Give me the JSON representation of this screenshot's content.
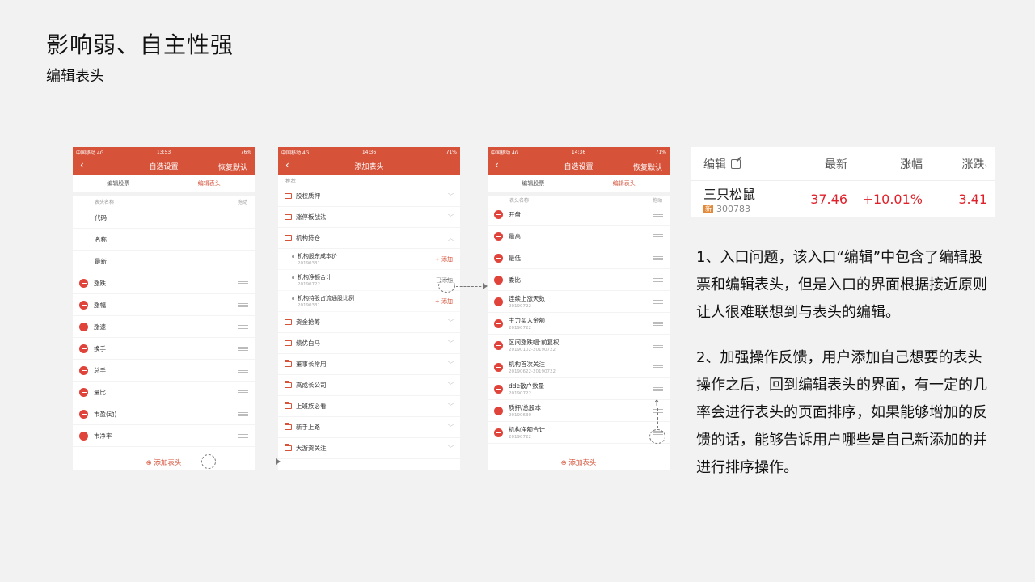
{
  "slide": {
    "title": "影响弱、自主性强",
    "subtitle": "编辑表头"
  },
  "status": {
    "carrier": "中国移动",
    "network": "4G"
  },
  "phone1": {
    "time": "13:53",
    "battery": "76%",
    "nav_title": "自选设置",
    "nav_right": "恢复默认",
    "tabs": [
      "编辑股票",
      "编辑表头"
    ],
    "col_name": "表头名称",
    "col_drag": "拖动",
    "fixed_items": [
      "代码",
      "名称",
      "最新"
    ],
    "items": [
      "涨跌",
      "涨幅",
      "涨速",
      "换手",
      "总手",
      "量比",
      "市盈(动)",
      "市净率"
    ],
    "add_label": "⊕ 添加表头"
  },
  "phone2": {
    "time": "14:36",
    "battery": "71%",
    "nav_title": "添加表头",
    "section": "推荐",
    "categories_top": [
      "股权质押",
      "涨停板战法",
      "机构持仓"
    ],
    "subitems": [
      {
        "name": "机构股东成本价",
        "date": "20190331",
        "action": "+ 添加"
      },
      {
        "name": "机构净额合计",
        "date": "20190722",
        "action": "已添加"
      },
      {
        "name": "机构持股占流通股比例",
        "date": "20190331",
        "action": "+ 添加"
      }
    ],
    "categories_bottom": [
      "资金抢筹",
      "绩优白马",
      "董事长常用",
      "高成长公司",
      "上班族必看",
      "新手上路",
      "大游资关注"
    ]
  },
  "phone3": {
    "time": "14:36",
    "battery": "71%",
    "nav_title": "自选设置",
    "nav_right": "恢复默认",
    "tabs": [
      "编辑股票",
      "编辑表头"
    ],
    "col_name": "表头名称",
    "col_drag": "拖动",
    "items": [
      {
        "name": "开盘",
        "date": ""
      },
      {
        "name": "最高",
        "date": ""
      },
      {
        "name": "最低",
        "date": ""
      },
      {
        "name": "委比",
        "date": ""
      },
      {
        "name": "连续上涨天数",
        "date": "20190722"
      },
      {
        "name": "主力买入金额",
        "date": "20190722"
      },
      {
        "name": "区间涨跌幅:前复权",
        "date": "20190102-20190722"
      },
      {
        "name": "机构首次关注",
        "date": "20190622-20190722"
      },
      {
        "name": "dde散户数量",
        "date": "20190722"
      },
      {
        "name": "质押/总股本",
        "date": "20190630"
      },
      {
        "name": "机构净额合计",
        "date": "20190722"
      }
    ],
    "add_label": "⊕ 添加表头"
  },
  "quote": {
    "headers": [
      "编辑",
      "最新",
      "涨幅",
      "涨跌"
    ],
    "name": "三只松鼠",
    "badge": "新",
    "code": "300783",
    "price": "37.46",
    "pct": "+10.01%",
    "change": "3.41"
  },
  "notes": [
    "1、入口问题，该入口“编辑”中包含了编辑股票和编辑表头，但是入口的界面根据接近原则让人很难联想到与表头的编辑。",
    "2、加强操作反馈，用户添加自己想要的表头操作之后，回到编辑表头的界面，有一定的几率会进行表头的页面排序，如果能够增加的反馈的话，能够告诉用户哪些是自己新添加的并进行排序操作。"
  ]
}
